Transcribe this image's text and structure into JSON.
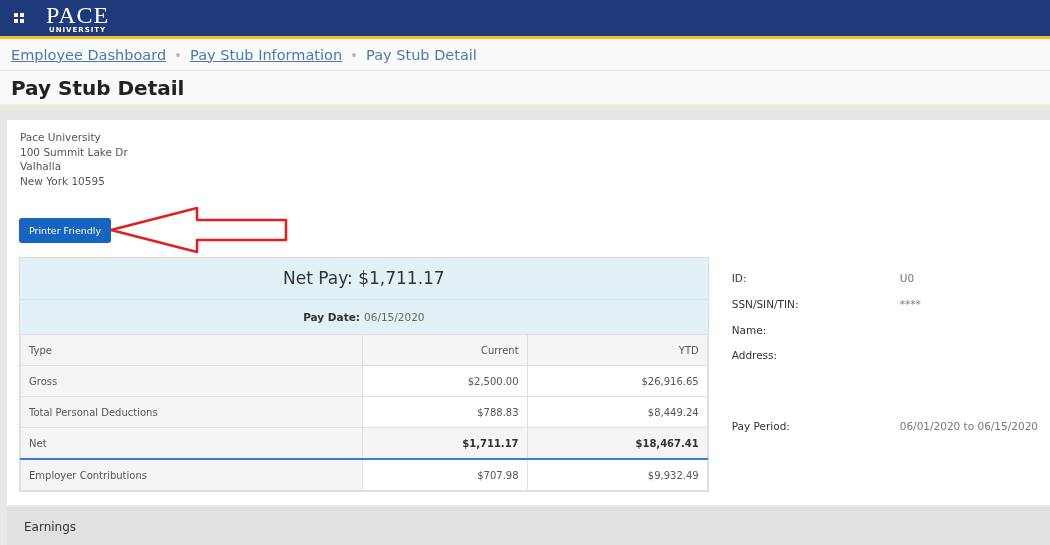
{
  "header": {
    "logo": {
      "word": "PACE",
      "sub": "UNIVERSITY"
    }
  },
  "breadcrumbs": [
    {
      "label": "Employee Dashboard",
      "link": true
    },
    {
      "label": "Pay Stub Information",
      "link": true
    },
    {
      "label": "Pay Stub Detail",
      "link": false
    }
  ],
  "page_title": "Pay Stub Detail",
  "employer_address": [
    "Pace University",
    "100 Summit Lake Dr",
    "Valhalla",
    "New York 10595"
  ],
  "printer_button": "Printer Friendly",
  "summary": {
    "net_pay": "Net Pay: $1,711.17",
    "pay_date_label": "Pay Date:",
    "pay_date": "06/15/2020"
  },
  "table": {
    "columns": [
      "Type",
      "Current",
      "YTD"
    ],
    "rows": [
      {
        "kind": "normal",
        "cells": [
          "Gross",
          "$2,500.00",
          "$26,916.65"
        ]
      },
      {
        "kind": "normal",
        "cells": [
          "Total Personal Deductions",
          "$788.83",
          "$8,449.24"
        ]
      },
      {
        "kind": "total",
        "cells": [
          "Net",
          "$1,711.17",
          "$18,467.41"
        ]
      },
      {
        "kind": "normal",
        "cells": [
          "Employer Contributions",
          "$707.98",
          "$9,932.49"
        ]
      }
    ]
  },
  "employee_info": [
    {
      "label": "ID:",
      "value": "U0"
    },
    {
      "label": "SSN/SIN/TIN:",
      "value": "****"
    },
    {
      "label": "Name:"
    },
    {
      "label": "Address:",
      "tall": true
    },
    {
      "label": "Pay Period:",
      "value": "06/01/2020 to 06/15/2020"
    }
  ],
  "sections": [
    {
      "title": "Earnings"
    }
  ]
}
